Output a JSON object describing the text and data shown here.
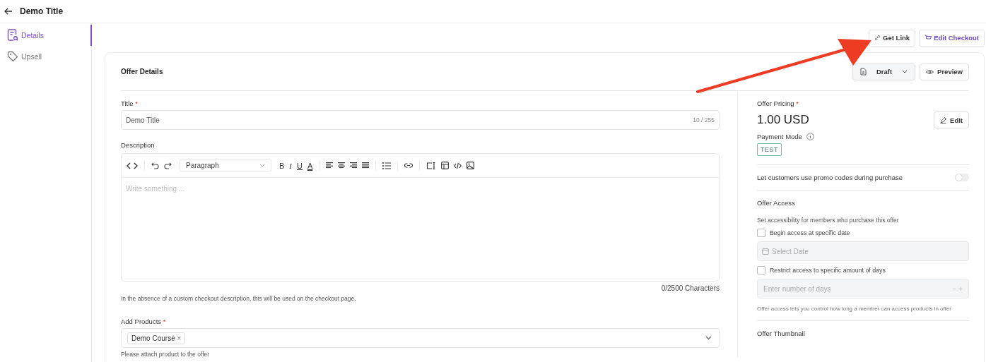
{
  "header": {
    "title": "Demo Title"
  },
  "sidebar": {
    "items": [
      {
        "label": "Details",
        "selected": true
      },
      {
        "label": "Upsell",
        "selected": false
      }
    ]
  },
  "top_actions": [
    {
      "label": "Get Link",
      "kind": "plain"
    },
    {
      "label": "Edit Checkout",
      "kind": "accent"
    }
  ],
  "card": {
    "title": "Offer Details",
    "status": {
      "label": "Draft"
    },
    "preview": {
      "label": "Preview"
    },
    "title_field": {
      "label": "Title",
      "required_mark": "*",
      "value": "Demo Title",
      "counter": "10 / 255"
    },
    "description": {
      "label": "Description",
      "toolbar": {
        "block_style": "Paragraph",
        "letters": [
          "B",
          "I",
          "U",
          "A"
        ]
      },
      "placeholder": "Write something ...",
      "counter": "0/2500 Characters",
      "help": "In the absence of a custom checkout description, this will be used on the checkout page."
    },
    "products": {
      "label": "Add Products",
      "required_mark": "*",
      "chips": [
        "Demo Course"
      ],
      "chip_remove": "×",
      "help": "Please attach product to the offer"
    },
    "pricing": {
      "label": "Offer Pricing",
      "required_mark": "*",
      "price": "1.00 USD",
      "edit": "Edit",
      "payment_mode_label": "Payment Mode",
      "payment_mode": "TEST"
    },
    "promo": {
      "label": "Let customers use promo codes during purchase",
      "on": false
    },
    "access": {
      "title": "Offer Access",
      "subtitle": "Set accessibility for members who purchase this offer",
      "options": [
        {
          "label": "Begin access at specific date",
          "checked": false,
          "kind": "date",
          "placeholder": "Select Date"
        },
        {
          "label": "Restrict access to specific amount of days",
          "checked": false,
          "kind": "number",
          "placeholder": "Enter number of days",
          "minus": "−",
          "plus": "+"
        }
      ],
      "help": "Offer access lets you control how long a member can access products in offer"
    },
    "thumbnail": {
      "title": "Offer Thumbnail"
    }
  }
}
